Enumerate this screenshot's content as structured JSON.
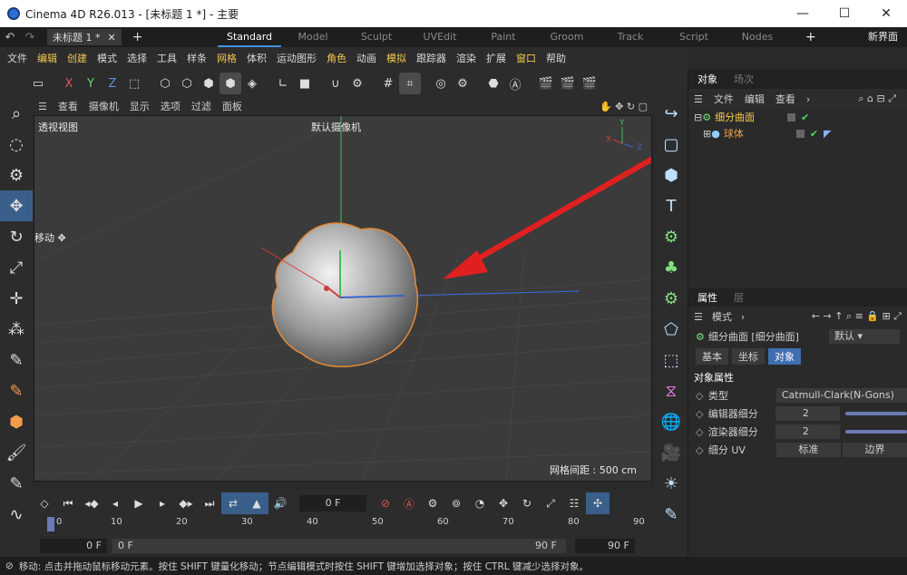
{
  "window": {
    "title": "Cinema 4D R26.013 - [未标题 1 *] - 主要",
    "controls": [
      "—",
      "☐",
      "✕"
    ]
  },
  "tabs": {
    "document": "未标题 1 *",
    "layouts": [
      "Standard",
      "Model",
      "Sculpt",
      "UVEdit",
      "Paint",
      "Groom",
      "Track",
      "Script",
      "Nodes"
    ],
    "active_layout": "Standard",
    "new_layout": "新界面"
  },
  "menu": [
    "文件",
    "编辑",
    "创建",
    "模式",
    "选择",
    "工具",
    "样条",
    "网格",
    "体积",
    "运动图形",
    "角色",
    "动画",
    "模拟",
    "跟踪器",
    "渲染",
    "扩展",
    "窗口",
    "帮助"
  ],
  "viewport": {
    "menu": [
      "查看",
      "摄像机",
      "显示",
      "选项",
      "过滤",
      "面板"
    ],
    "view_name": "透视视图",
    "camera": "默认摄像机",
    "grid_spacing": "网格间距 : 500 cm",
    "move_label": "移动",
    "axis_labels": {
      "x": "X",
      "y": "Y",
      "z": "Z"
    }
  },
  "object_manager": {
    "tabs": [
      "对象",
      "场次"
    ],
    "menu": [
      "文件",
      "编辑",
      "查看"
    ],
    "objects": [
      {
        "name": "细分曲面",
        "child": false
      },
      {
        "name": "球体",
        "child": true
      }
    ]
  },
  "attributes": {
    "tabs": [
      "属性",
      "层"
    ],
    "mode_label": "模式",
    "object_title": "细分曲面 [细分曲面]",
    "preset": "默认",
    "subtabs": [
      "基本",
      "坐标",
      "对象"
    ],
    "active_subtab": "对象",
    "section": "对象属性",
    "props": [
      {
        "label": "类型",
        "value": "Catmull-Clark(N-Gons)"
      },
      {
        "label": "编辑器细分",
        "value": "2"
      },
      {
        "label": "渲染器细分",
        "value": "2"
      },
      {
        "label": "细分 UV",
        "value": "标准",
        "value2": "边界"
      }
    ]
  },
  "timeline": {
    "current_frame": "0 F",
    "ticks": [
      "0",
      "10",
      "20",
      "30",
      "40",
      "50",
      "60",
      "70",
      "80",
      "90"
    ],
    "range_start": "0 F",
    "range_min": "0 F",
    "range_max": "90 F",
    "range_end": "90 F",
    "end_tick": "90"
  },
  "status": "移动: 点击并拖动鼠标移动元素。按住 SHIFT 键量化移动；节点编辑模式时按住 SHIFT 键增加选择对象；按住 CTRL 键减少选择对象。"
}
